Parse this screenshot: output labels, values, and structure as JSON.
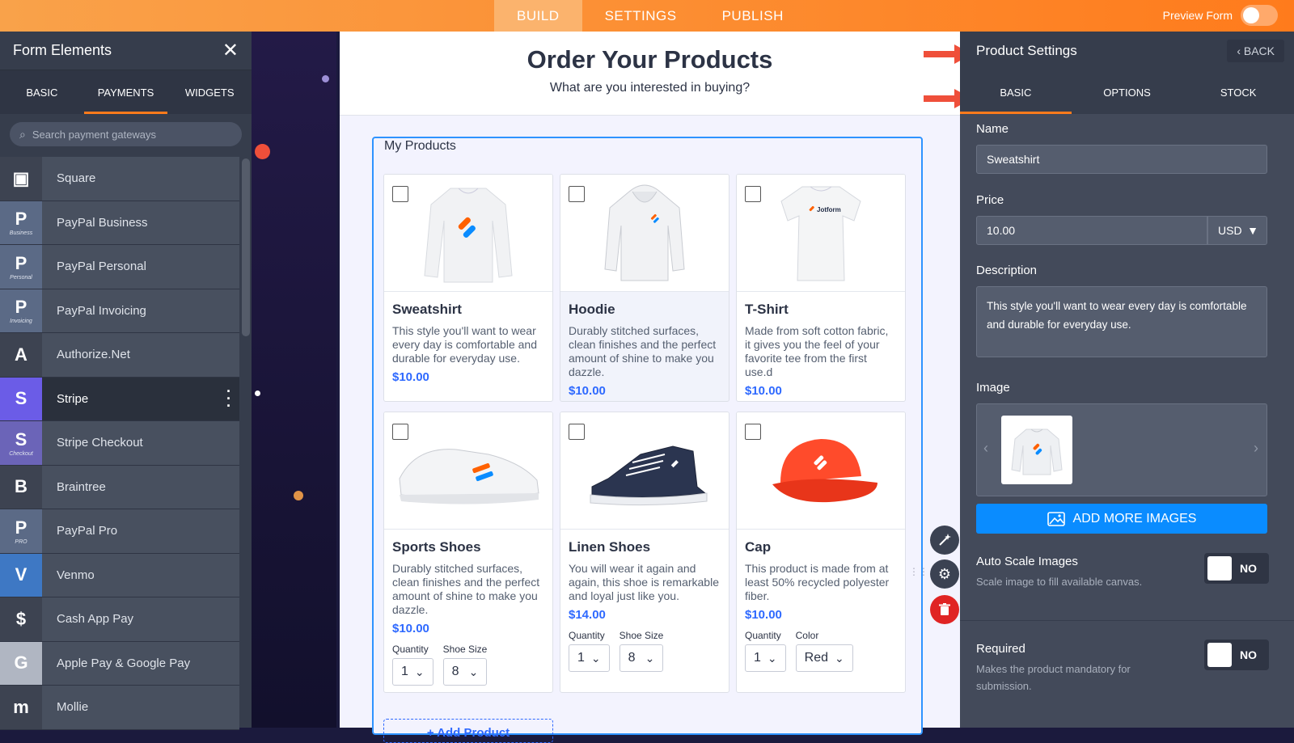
{
  "topbar": {
    "tabs": [
      "BUILD",
      "SETTINGS",
      "PUBLISH"
    ],
    "active_tab": "BUILD",
    "preview_label": "Preview Form"
  },
  "left_panel": {
    "title": "Form Elements",
    "tabs": [
      "BASIC",
      "PAYMENTS",
      "WIDGETS"
    ],
    "active_tab": "PAYMENTS",
    "search_placeholder": "Search payment gateways",
    "items": [
      {
        "label": "Square",
        "icon": "square-logo-icon",
        "color": "#3d4351",
        "glyph": "▣",
        "sub": ""
      },
      {
        "label": "PayPal Business",
        "icon": "paypal-icon",
        "color": "#5b6a86",
        "glyph": "P",
        "sub": "Business"
      },
      {
        "label": "PayPal Personal",
        "icon": "paypal-icon",
        "color": "#5b6a86",
        "glyph": "P",
        "sub": "Personal"
      },
      {
        "label": "PayPal Invoicing",
        "icon": "paypal-icon",
        "color": "#5b6a86",
        "glyph": "P",
        "sub": "Invoicing"
      },
      {
        "label": "Authorize.Net",
        "icon": "authorize-net-icon",
        "color": "#3d4351",
        "glyph": "A",
        "sub": ""
      },
      {
        "label": "Stripe",
        "icon": "stripe-icon",
        "color": "#6b5ce7",
        "glyph": "S",
        "sub": ""
      },
      {
        "label": "Stripe Checkout",
        "icon": "stripe-checkout-icon",
        "color": "#6b64b8",
        "glyph": "S",
        "sub": "Checkout"
      },
      {
        "label": "Braintree",
        "icon": "braintree-icon",
        "color": "#3d4351",
        "glyph": "B",
        "sub": ""
      },
      {
        "label": "PayPal Pro",
        "icon": "paypal-icon",
        "color": "#5b6a86",
        "glyph": "P",
        "sub": "PRO"
      },
      {
        "label": "Venmo",
        "icon": "venmo-icon",
        "color": "#3e78c4",
        "glyph": "V",
        "sub": ""
      },
      {
        "label": "Cash App Pay",
        "icon": "cash-app-icon",
        "color": "#3d4351",
        "glyph": "$",
        "sub": ""
      },
      {
        "label": "Apple Pay & Google Pay",
        "icon": "apple-google-pay-icon",
        "color": "#b0b6c2",
        "glyph": "G",
        "sub": ""
      },
      {
        "label": "Mollie",
        "icon": "mollie-icon",
        "color": "#3d4351",
        "glyph": "m",
        "sub": ""
      }
    ],
    "active_item": "Stripe"
  },
  "form": {
    "title": "Order Your Products",
    "subtitle": "What are you interested in buying?",
    "products_label": "My Products",
    "add_product": "+ Add Product",
    "products": [
      {
        "name": "Sweatshirt",
        "desc": "This style you'll want to wear every day is comfortable and durable for everyday use.",
        "price": "$10.00",
        "image": "sweatshirt-image"
      },
      {
        "name": "Hoodie",
        "desc": "Durably stitched surfaces, clean finishes and the perfect amount of shine to make you dazzle.",
        "price": "$10.00",
        "image": "hoodie-image"
      },
      {
        "name": "T-Shirt",
        "desc": "Made from soft cotton fabric, it gives you the feel of your favorite tee from the first use.d",
        "price": "$10.00",
        "image": "tshirt-image"
      },
      {
        "name": "Sports Shoes",
        "desc": "Durably stitched surfaces, clean finishes and the perfect amount of shine to make you dazzle.",
        "price": "$10.00",
        "image": "sports-shoes-image",
        "options": [
          {
            "label": "Quantity",
            "value": "1"
          },
          {
            "label": "Shoe Size",
            "value": "8"
          }
        ]
      },
      {
        "name": "Linen Shoes",
        "desc": "You will wear it again and again, this shoe is remarkable and loyal just like you.",
        "price": "$14.00",
        "image": "linen-shoes-image",
        "options": [
          {
            "label": "Quantity",
            "value": "1"
          },
          {
            "label": "Shoe Size",
            "value": "8"
          }
        ]
      },
      {
        "name": "Cap",
        "desc": "This product is made from at least 50% recycled polyester fiber.",
        "price": "$10.00",
        "image": "cap-image",
        "options": [
          {
            "label": "Quantity",
            "value": "1"
          },
          {
            "label": "Color",
            "value": "Red"
          }
        ]
      }
    ]
  },
  "right_panel": {
    "title": "Product Settings",
    "back_label": "BACK",
    "tabs": [
      "BASIC",
      "OPTIONS",
      "STOCK"
    ],
    "active_tab": "BASIC",
    "name_label": "Name",
    "name_value": "Sweatshirt",
    "price_label": "Price",
    "price_value": "10.00",
    "currency": "USD",
    "description_label": "Description",
    "description_value": "This style you'll want to wear every day is comfortable and durable for everyday use.",
    "image_label": "Image",
    "add_images": "ADD MORE IMAGES",
    "auto_scale_label": "Auto Scale Images",
    "auto_scale_hint": "Scale image to fill available canvas.",
    "auto_scale_value": "NO",
    "required_label": "Required",
    "required_hint": "Makes the product mandatory for submission.",
    "required_value": "NO"
  },
  "colors": {
    "accent_orange": "#ff7b1c",
    "price_blue": "#2e69ff",
    "button_blue": "#0a8cff",
    "annotation_red": "#ef4f3a",
    "delete_red": "#e02424"
  }
}
